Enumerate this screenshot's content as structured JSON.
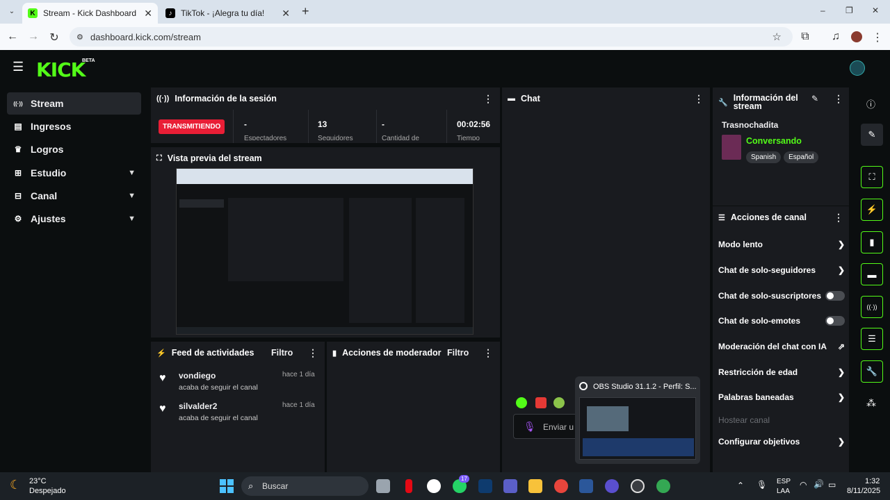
{
  "browser": {
    "tabs": [
      {
        "title": "Stream - Kick Dashboard",
        "active": true
      },
      {
        "title": "TikTok - ¡Alegra tu día!",
        "active": false
      }
    ],
    "new_tab": "+",
    "url": "dashboard.kick.com/stream",
    "window_controls": {
      "minimize": "–",
      "restore": "❐",
      "close": "✕"
    }
  },
  "app": {
    "logo": "KICK",
    "beta": "BETA",
    "sidebar": [
      {
        "label": "Stream",
        "icon": "stream-icon",
        "glyph": "((·))",
        "active": true
      },
      {
        "label": "Ingresos",
        "icon": "chart-icon",
        "glyph": "▤"
      },
      {
        "label": "Logros",
        "icon": "trophy-icon",
        "glyph": "♛"
      },
      {
        "label": "Estudio",
        "icon": "studio-icon",
        "glyph": "⊞",
        "expandable": true
      },
      {
        "label": "Canal",
        "icon": "channel-icon",
        "glyph": "⊟",
        "expandable": true
      },
      {
        "label": "Ajustes",
        "icon": "gear-icon",
        "glyph": "⚙",
        "expandable": true
      }
    ],
    "session": {
      "title": "Información de la sesión",
      "status": "TRANSMITIENDO",
      "stats": [
        {
          "value": "-",
          "label": "Espectadores"
        },
        {
          "value": "13",
          "label": "Seguidores"
        },
        {
          "value": "-",
          "label": "Cantidad de"
        },
        {
          "value": "00:02:56",
          "label": "Tiempo"
        }
      ]
    },
    "preview": {
      "title": "Vista previa del stream"
    },
    "chat": {
      "title": "Chat",
      "input_placeholder": "Enviar u"
    },
    "stream_info": {
      "title": "Información del stream",
      "stream_title": "Trasnochadita",
      "category": "Conversando",
      "tags": [
        "Spanish",
        "Español"
      ]
    },
    "channel_actions": {
      "title": "Acciones de canal",
      "items": [
        {
          "label": "Modo lento",
          "control": "arrow"
        },
        {
          "label": "Chat de solo-seguidores",
          "control": "arrow"
        },
        {
          "label": "Chat de solo-suscriptores",
          "control": "toggle"
        },
        {
          "label": "Chat de solo-emotes",
          "control": "toggle"
        },
        {
          "label": "Moderación del chat con IA",
          "control": "external"
        },
        {
          "label": "Restricción de edad",
          "control": "arrow"
        },
        {
          "label": "Palabras baneadas",
          "control": "arrow"
        },
        {
          "label": "Hostear canal",
          "control": "disabled"
        },
        {
          "label": "Configurar objetivos",
          "control": "arrow"
        }
      ]
    },
    "activity": {
      "title": "Feed de actividades",
      "filter": "Filtro",
      "items": [
        {
          "user": "vondiego",
          "text": "acaba de seguir el canal",
          "time": "hace 1 día"
        },
        {
          "user": "silvalder2",
          "text": "acaba de seguir el canal",
          "time": "hace 1 día"
        }
      ]
    },
    "moderator": {
      "title": "Acciones de moderador",
      "filter": "Filtro"
    },
    "obs_popup": {
      "title": "OBS Studio 31.1.2 - Perfil: S..."
    }
  },
  "taskbar": {
    "weather_temp": "23°C",
    "weather_desc": "Despejado",
    "search": "Buscar",
    "badge": "17",
    "lang1": "ESP",
    "lang2": "LAA",
    "time": "1:32",
    "date": "8/11/2025"
  },
  "colors": {
    "kick_green": "#53fc18",
    "live_red": "#e91e36",
    "panel": "#191b1f"
  }
}
